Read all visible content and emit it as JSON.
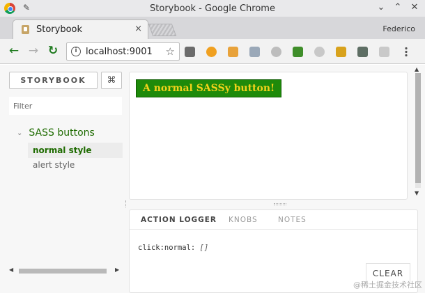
{
  "window": {
    "title": "Storybook - Google Chrome",
    "controls": {
      "minimize": "⌄",
      "maximize": "⌃",
      "close": "✕"
    },
    "pin_icon": "pin-icon"
  },
  "tabs": [
    {
      "label": "Storybook",
      "close": "×"
    }
  ],
  "profile_name": "Federico",
  "toolbar": {
    "back": "←",
    "forward": "→",
    "reload": "↻",
    "url": "localhost:9001",
    "star": "☆",
    "info": "i",
    "extensions": [
      {
        "name": "gear-extension-icon",
        "color": "#6b6b6b"
      },
      {
        "name": "orange-circle-extension-icon",
        "color": "#f0a020"
      },
      {
        "name": "mail-extension-icon",
        "color": "#e8a23a"
      },
      {
        "name": "dropbox-extension-icon",
        "color": "#9aa8b8"
      },
      {
        "name": "circle-extension-icon",
        "color": "#bdbdbd"
      },
      {
        "name": "green-square-extension-icon",
        "color": "#3f8e2a"
      },
      {
        "name": "grey-swirl-extension-icon",
        "color": "#c8c8c8"
      },
      {
        "name": "yellow-box-extension-icon",
        "color": "#d8a21c"
      },
      {
        "name": "s-extension-icon",
        "color": "#5e6e64"
      },
      {
        "name": "g-extension-icon",
        "color": "#c9c9c9"
      },
      {
        "name": "menu-icon",
        "color": "#555555"
      }
    ]
  },
  "sidebar": {
    "brand_label": "STORYBOOK",
    "shortcut_label": "⌘",
    "filter_placeholder": "Filter",
    "group": {
      "label": "SASS buttons",
      "chevron": "⌄",
      "stories": [
        {
          "label": "normal style",
          "active": true
        },
        {
          "label": "alert style",
          "active": false
        }
      ]
    },
    "scroll_left": "◀",
    "scroll_right": "▶"
  },
  "preview": {
    "button_label": "A normal SASSy button!",
    "scroll_up": "▲",
    "scroll_down": "▼"
  },
  "addons": {
    "tabs": [
      {
        "label": "ACTION LOGGER",
        "active": true
      },
      {
        "label": "KNOBS",
        "active": false
      },
      {
        "label": "NOTES",
        "active": false
      }
    ],
    "log": {
      "name": "click:normal:",
      "value": "[]"
    },
    "clear_label": "CLEAR"
  },
  "watermark": "@稀土掘金技术社区",
  "colors": {
    "accent_green": "#1e6b00",
    "sass_button_bg": "#1e8a0a",
    "sass_button_text": "#f2d21a"
  }
}
